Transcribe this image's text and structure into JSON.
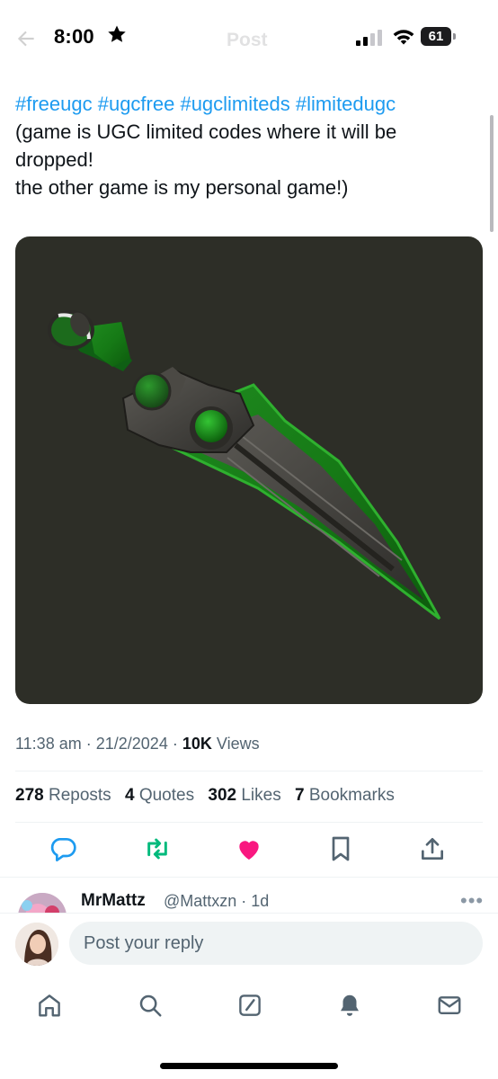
{
  "status_bar": {
    "time": "8:00",
    "battery": "61"
  },
  "header": {
    "title": "Post"
  },
  "tweet": {
    "hashtags": "#freeugc #ugcfree #ugclimiteds #limitedugc",
    "line1": "(game is UGC limited codes where it will be",
    "line2": "dropped!",
    "line3": "the other game is my personal game!)",
    "image_alt": "green dagger",
    "time": "11:38 am",
    "date": "21/2/2024",
    "views_count": "10K",
    "views_label": "Views"
  },
  "stats": {
    "reposts_count": "278",
    "reposts_label": "Reposts",
    "quotes_count": "4",
    "quotes_label": "Quotes",
    "likes_count": "302",
    "likes_label": "Likes",
    "bookmarks_count": "7",
    "bookmarks_label": "Bookmarks"
  },
  "reply": {
    "name": "MrMattz",
    "handle": "@Mattxzn",
    "age": "1d",
    "more": "•••"
  },
  "compose": {
    "placeholder": "Post your reply"
  },
  "colors": {
    "accent": "#1d9bf0",
    "repost_green": "#00ba7c",
    "like_pink": "#f91880",
    "media_bg": "#2d2e27"
  },
  "icons": [
    "back-arrow-icon",
    "star-icon",
    "signal-icon",
    "wifi-icon",
    "battery-icon",
    "reply-icon",
    "repost-icon",
    "like-icon",
    "bookmark-icon",
    "share-icon",
    "more-icon",
    "home-icon",
    "search-icon",
    "grok-icon",
    "notifications-icon",
    "messages-icon"
  ]
}
